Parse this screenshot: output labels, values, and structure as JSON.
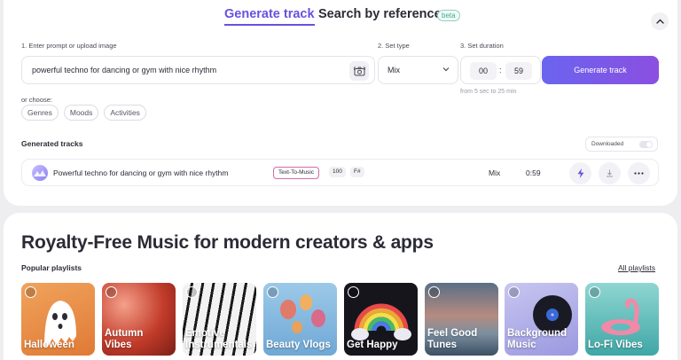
{
  "tabs": {
    "generate": "Generate track",
    "search": "Search by reference",
    "beta": "beta"
  },
  "form": {
    "prompt_label": "1. Enter prompt or upload image",
    "prompt_value": "powerful techno for dancing or gym with nice rhythm",
    "type_label": "2. Set type",
    "type_value": "Mix",
    "duration_label": "3. Set duration",
    "duration_minutes": "00",
    "duration_seconds": "59",
    "duration_hint": "from 5 sec to 25 min",
    "generate_button": "Generate track",
    "or_choose": "or choose:",
    "chips": [
      "Genres",
      "Moods",
      "Activities"
    ]
  },
  "generated": {
    "title": "Generated tracks",
    "downloaded_label": "Downloaded",
    "track": {
      "title": "Powerful techno for dancing or gym with nice rhythm",
      "tag": "Text-To-Music",
      "bpm": "100",
      "key": "F#",
      "type": "Mix",
      "duration": "0:59"
    }
  },
  "royalty": {
    "heading": "Royalty-Free Music for modern creators & apps",
    "popular_label": "Popular playlists",
    "all_playlists": "All playlists",
    "playlists": [
      {
        "line1": "Halloween",
        "line2": ""
      },
      {
        "line1": "Autumn",
        "line2": "Vibes"
      },
      {
        "line1": "Emotive",
        "line2": "Instrumentals"
      },
      {
        "line1": "Beauty Vlogs",
        "line2": ""
      },
      {
        "line1": "Get Happy",
        "line2": ""
      },
      {
        "line1": "Feel Good",
        "line2": "Tunes"
      },
      {
        "line1": "Background",
        "line2": "Music"
      },
      {
        "line1": "Lo-Fi Vibes",
        "line2": ""
      }
    ]
  },
  "colors": {
    "accent": "#6a4fe0",
    "button_start": "#6a64f0",
    "button_end": "#8b4fe0",
    "beta": "#3ca98e",
    "tag_border": "#d46aa8"
  }
}
